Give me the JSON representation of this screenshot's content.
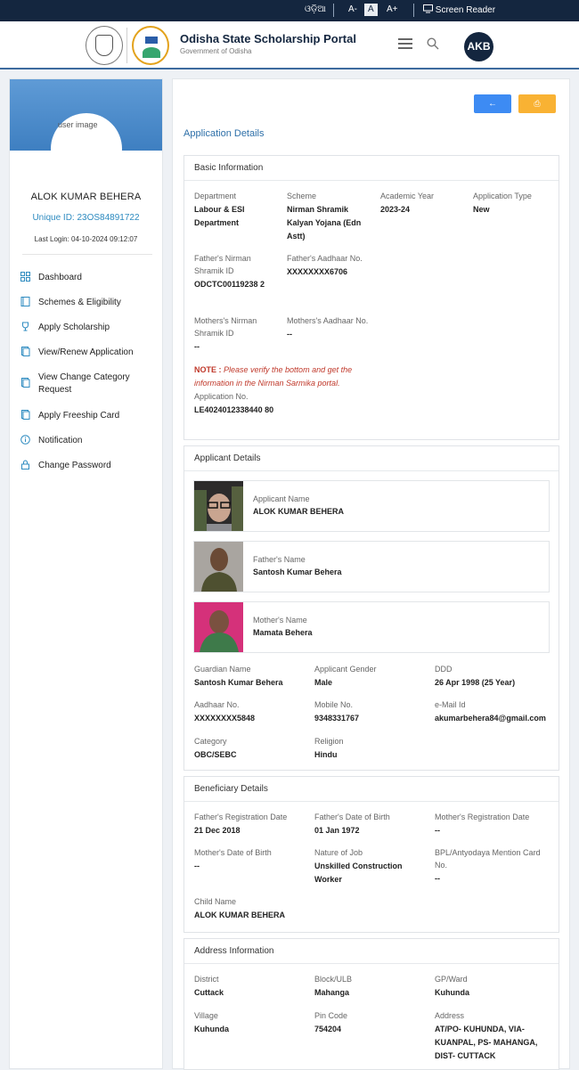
{
  "topbar": {
    "language": "ଓଡ଼ିଆ",
    "font_decrease": "A-",
    "font_normal": "A",
    "font_increase": "A+",
    "screen_reader": "Screen Reader"
  },
  "header": {
    "title": "Odisha State Scholarship Portal",
    "subtitle": "Government of Odisha",
    "avatar_initials": "AKB"
  },
  "sidebar": {
    "image_alt": "user image",
    "name": "ALOK KUMAR BEHERA",
    "unique_id": "Unique ID: 23OS84891722",
    "last_login": "Last Login: 04-10-2024 09:12:07",
    "nav": [
      {
        "label": "Dashboard",
        "icon": "grid-icon"
      },
      {
        "label": "Schemes & Eligibility",
        "icon": "book-icon"
      },
      {
        "label": "Apply Scholarship",
        "icon": "trophy-icon"
      },
      {
        "label": "View/Renew Application",
        "icon": "document-icon"
      },
      {
        "label": "View Change Category Request",
        "icon": "document-icon"
      },
      {
        "label": "Apply Freeship Card",
        "icon": "card-icon"
      },
      {
        "label": "Notification",
        "icon": "info-icon"
      },
      {
        "label": "Change Password",
        "icon": "lock-icon"
      }
    ]
  },
  "main": {
    "back_label": "←",
    "print_label": "⎙",
    "section_title": "Application Details",
    "basic": {
      "title": "Basic Information",
      "department_label": "Department",
      "department_value": "Labour & ESI Department",
      "scheme_label": "Scheme",
      "scheme_value": "Nirman Shramik Kalyan Yojana (Edn Astt)",
      "academic_year_label": "Academic Year",
      "academic_year_value": "2023-24",
      "application_type_label": "Application Type",
      "application_type_value": "New",
      "father_nirman_label": "Father's Nirman Shramik ID",
      "father_nirman_value": "ODCTC00119238 2",
      "father_aadhaar_label": "Father's Aadhaar No.",
      "father_aadhaar_value": "XXXXXXXX6706",
      "mother_nirman_label": "Mothers's Nirman Shramik ID",
      "mother_nirman_value": "--",
      "mother_aadhaar_label": "Mothers's Aadhaar No.",
      "mother_aadhaar_value": "--",
      "note_prefix": "NOTE :",
      "note_text": "Please verify the bottom and get the information in the Nirman Sarmika portal.",
      "application_no_label": "Application No.",
      "application_no_value": "LE4024012338440 80"
    },
    "applicant": {
      "title": "Applicant Details",
      "applicant_name_label": "Applicant Name",
      "applicant_name_value": "ALOK KUMAR BEHERA",
      "father_name_label": "Father's Name",
      "father_name_value": "Santosh Kumar Behera",
      "mother_name_label": "Mother's Name",
      "mother_name_value": "Mamata Behera",
      "guardian_label": "Guardian Name",
      "guardian_value": "Santosh Kumar Behera",
      "gender_label": "Applicant Gender",
      "gender_value": "Male",
      "dob_label": "DDD",
      "dob_value": "26 Apr 1998 (25 Year)",
      "aadhaar_label": "Aadhaar No.",
      "aadhaar_value": "XXXXXXXX5848",
      "mobile_label": "Mobile No.",
      "mobile_value": "9348331767",
      "email_label": "e-Mail Id",
      "email_value": "akumarbehera84@gmail.com",
      "category_label": "Category",
      "category_value": "OBC/SEBC",
      "religion_label": "Religion",
      "religion_value": "Hindu"
    },
    "beneficiary": {
      "title": "Beneficiary Details",
      "father_reg_label": "Father's Registration Date",
      "father_reg_value": "21 Dec 2018",
      "father_dob_label": "Father's Date of Birth",
      "father_dob_value": "01 Jan 1972",
      "mother_reg_label": "Mother's Registration Date",
      "mother_reg_value": "--",
      "mother_dob_label": "Mother's Date of Birth",
      "mother_dob_value": "--",
      "job_label": "Nature of Job",
      "job_value": "Unskilled Construction Worker",
      "bpl_label": "BPL/Antyodaya Mention Card No.",
      "bpl_value": "--",
      "child_label": "Child Name",
      "child_value": "ALOK KUMAR BEHERA"
    },
    "address": {
      "title": "Address Information",
      "district_label": "District",
      "district_value": "Cuttack",
      "block_label": "Block/ULB",
      "block_value": "Mahanga",
      "gp_label": "GP/Ward",
      "gp_value": "Kuhunda",
      "village_label": "Village",
      "village_value": "Kuhunda",
      "pin_label": "Pin Code",
      "pin_value": "754204",
      "address_label": "Address",
      "address_value": "AT/PO- KUHUNDA, VIA- KUANPAL, PS- MAHANGA, DIST- CUTTACK"
    }
  }
}
